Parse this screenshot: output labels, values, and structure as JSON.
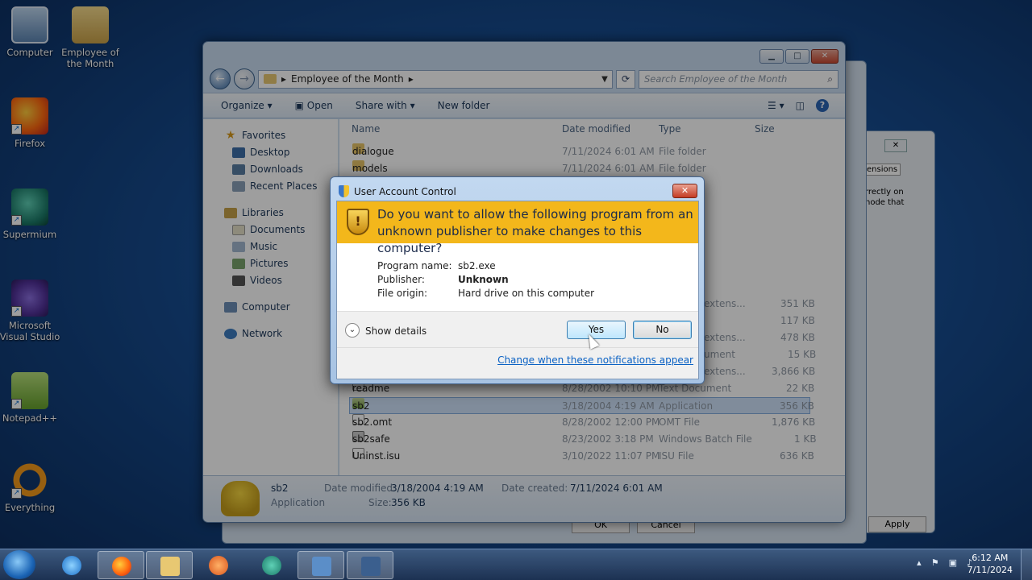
{
  "desktop": {
    "icons": [
      {
        "label": "Computer",
        "icon": "computer-icon"
      },
      {
        "label": "Employee of the Month",
        "icon": "folder-icon"
      },
      {
        "label": "Firefox",
        "icon": "firefox-icon"
      },
      {
        "label": "Supermium",
        "icon": "supermium-icon"
      },
      {
        "label": "Microsoft Visual Studio",
        "icon": "visual-studio-icon"
      },
      {
        "label": "Notepad++",
        "icon": "notepadpp-icon"
      },
      {
        "label": "Everything",
        "icon": "everything-icon"
      }
    ]
  },
  "explorer": {
    "address": "Employee of the Month",
    "search_placeholder": "Search Employee of the Month",
    "toolbar": {
      "organize": "Organize",
      "open": "Open",
      "share_with": "Share with",
      "new_folder": "New folder"
    },
    "nav": {
      "favorites": "Favorites",
      "desktop": "Desktop",
      "downloads": "Downloads",
      "recent_places": "Recent Places",
      "libraries": "Libraries",
      "documents": "Documents",
      "music": "Music",
      "pictures": "Pictures",
      "videos": "Videos",
      "computer": "Computer",
      "network": "Network"
    },
    "columns": {
      "name": "Name",
      "date_modified": "Date modified",
      "type": "Type",
      "size": "Size"
    },
    "rows": [
      {
        "name": "dialogue",
        "date": "7/11/2024 6:01 AM",
        "type": "File folder",
        "size": ""
      },
      {
        "name": "models",
        "date": "7/11/2024 6:01 AM",
        "type": "File folder",
        "size": ""
      },
      {
        "name": "",
        "date": "",
        "type": "extens...",
        "size": "351 KB"
      },
      {
        "name": "",
        "date": "",
        "type": "",
        "size": "117 KB"
      },
      {
        "name": "",
        "date": "",
        "type": "extens...",
        "size": "478 KB"
      },
      {
        "name": "",
        "date": "",
        "type": "ument",
        "size": "15 KB"
      },
      {
        "name": "",
        "date": "",
        "type": "extens...",
        "size": "3,866 KB"
      },
      {
        "name": "readme",
        "date": "8/28/2002 10:10 PM",
        "type": "Text Document",
        "size": "22 KB"
      },
      {
        "name": "sb2",
        "date": "3/18/2004 4:19 AM",
        "type": "Application",
        "size": "356 KB"
      },
      {
        "name": "sb2.omt",
        "date": "8/28/2002 12:00 PM",
        "type": "OMT File",
        "size": "1,876 KB"
      },
      {
        "name": "sb2safe",
        "date": "8/23/2002 3:18 PM",
        "type": "Windows Batch File",
        "size": "1 KB"
      },
      {
        "name": "Uninst.isu",
        "date": "3/10/2022 11:07 PM",
        "type": "ISU File",
        "size": "636 KB"
      }
    ],
    "details": {
      "name": "sb2",
      "kind": "Application",
      "date_modified_label": "Date modified:",
      "date_modified": "3/18/2004 4:19 AM",
      "size_label": "Size:",
      "size": "356 KB",
      "date_created_label": "Date created:",
      "date_created": "7/11/2024 6:01 AM"
    }
  },
  "uac": {
    "title": "User Account Control",
    "question": "Do you want to allow the following program from an unknown publisher to make changes to this computer?",
    "program_name_label": "Program name:",
    "program_name": "sb2.exe",
    "publisher_label": "Publisher:",
    "publisher": "Unknown",
    "file_origin_label": "File origin:",
    "file_origin": "Hard drive on this computer",
    "show_details": "Show details",
    "yes": "Yes",
    "no": "No",
    "link": "Change when these notifications appear"
  },
  "background_window": {
    "tab": "ensions",
    "text1": "rrectly on",
    "text2": "node that",
    "ok": "OK",
    "cancel": "Cancel",
    "apply": "Apply"
  },
  "taskbar": {
    "time": "6:12 AM",
    "date": "7/11/2024"
  }
}
